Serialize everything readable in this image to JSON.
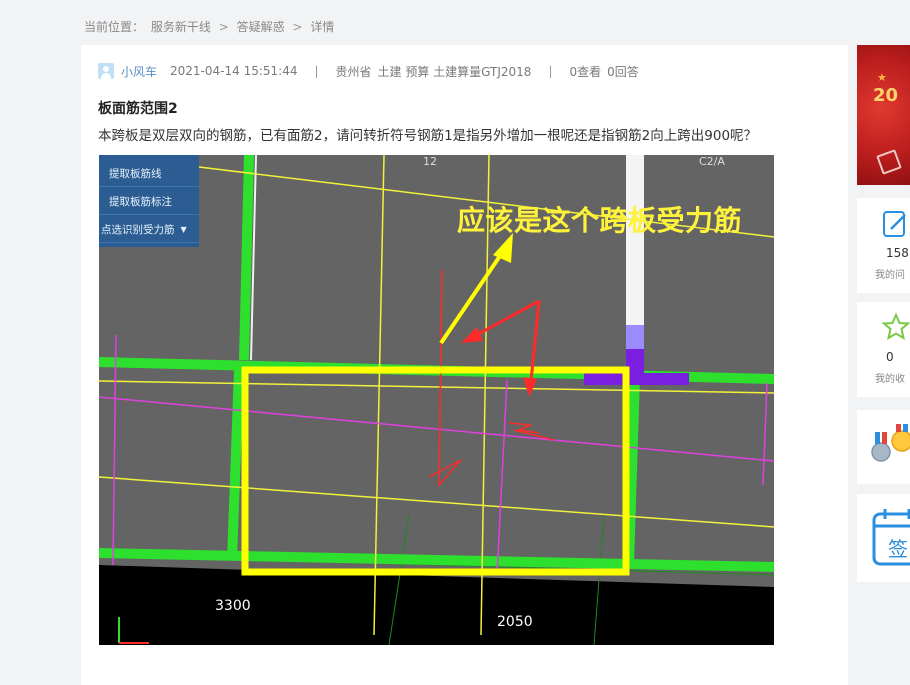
{
  "breadcrumb": {
    "prefix": "当前位置：",
    "items": [
      "服务新干线",
      "答疑解惑",
      "详情"
    ],
    "separator": ">"
  },
  "post": {
    "author": "小风车",
    "datetime": "2021-04-14 15:51:44",
    "region": "贵州省",
    "tags": "土建 预算 土建算量GTJ2018",
    "views": "0查看",
    "answers": "0回答",
    "title": "板面筋范围2",
    "body": "本跨板是双层双向的钢筋，已有面筋2，请问转折符号钢筋1是指另外增加一根呢还是指钢筋2向上跨出900呢？"
  },
  "figure": {
    "tool_buttons": [
      "提取板筋线",
      "提取板筋标注",
      "点选识别受力筋"
    ],
    "annotation": "应该是这个跨板受力筋",
    "dimension_labels": [
      "3300",
      "2050"
    ],
    "grid_labels": [
      "12",
      "C2/A"
    ],
    "colors": {
      "background": "#646464",
      "beam_green": "#2ee02e",
      "rebar_yellow": "#f2f23a",
      "rebar_magenta": "#e040e0",
      "highlight_box": "#ffff00",
      "arrow_red": "#ff2a2a"
    }
  },
  "sidebar": {
    "banner_text": "20",
    "my_questions": {
      "count": "158",
      "label": "我的问"
    },
    "my_favorites": {
      "count": "0",
      "label": "我的收"
    },
    "medal_icon": "medal-icon",
    "checkin_label": "签"
  }
}
